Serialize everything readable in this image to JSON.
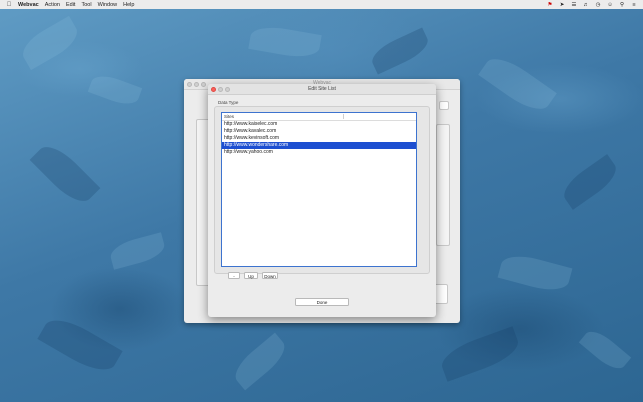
{
  "menubar": {
    "items": [
      "Webvac",
      "Action",
      "Edit",
      "Tool",
      "Window",
      "Help"
    ]
  },
  "back_window": {
    "title": "Webvac"
  },
  "sheet": {
    "title": "Edit Site List",
    "group_label": "Data Type",
    "column_header": "Sites",
    "sites": [
      "http://www.kaiselec.com",
      "http://www.kavalec.com",
      "http://www.kevinsoft.com",
      "http://www.wondershare.com",
      "http://www.yahoo.com"
    ],
    "selected_index": 3,
    "buttons": {
      "remove": "-",
      "up": "Up",
      "down": "Down",
      "done": "Done"
    }
  },
  "colors": {
    "selection": "#1d4fd1",
    "table_border": "#3d73cf"
  }
}
